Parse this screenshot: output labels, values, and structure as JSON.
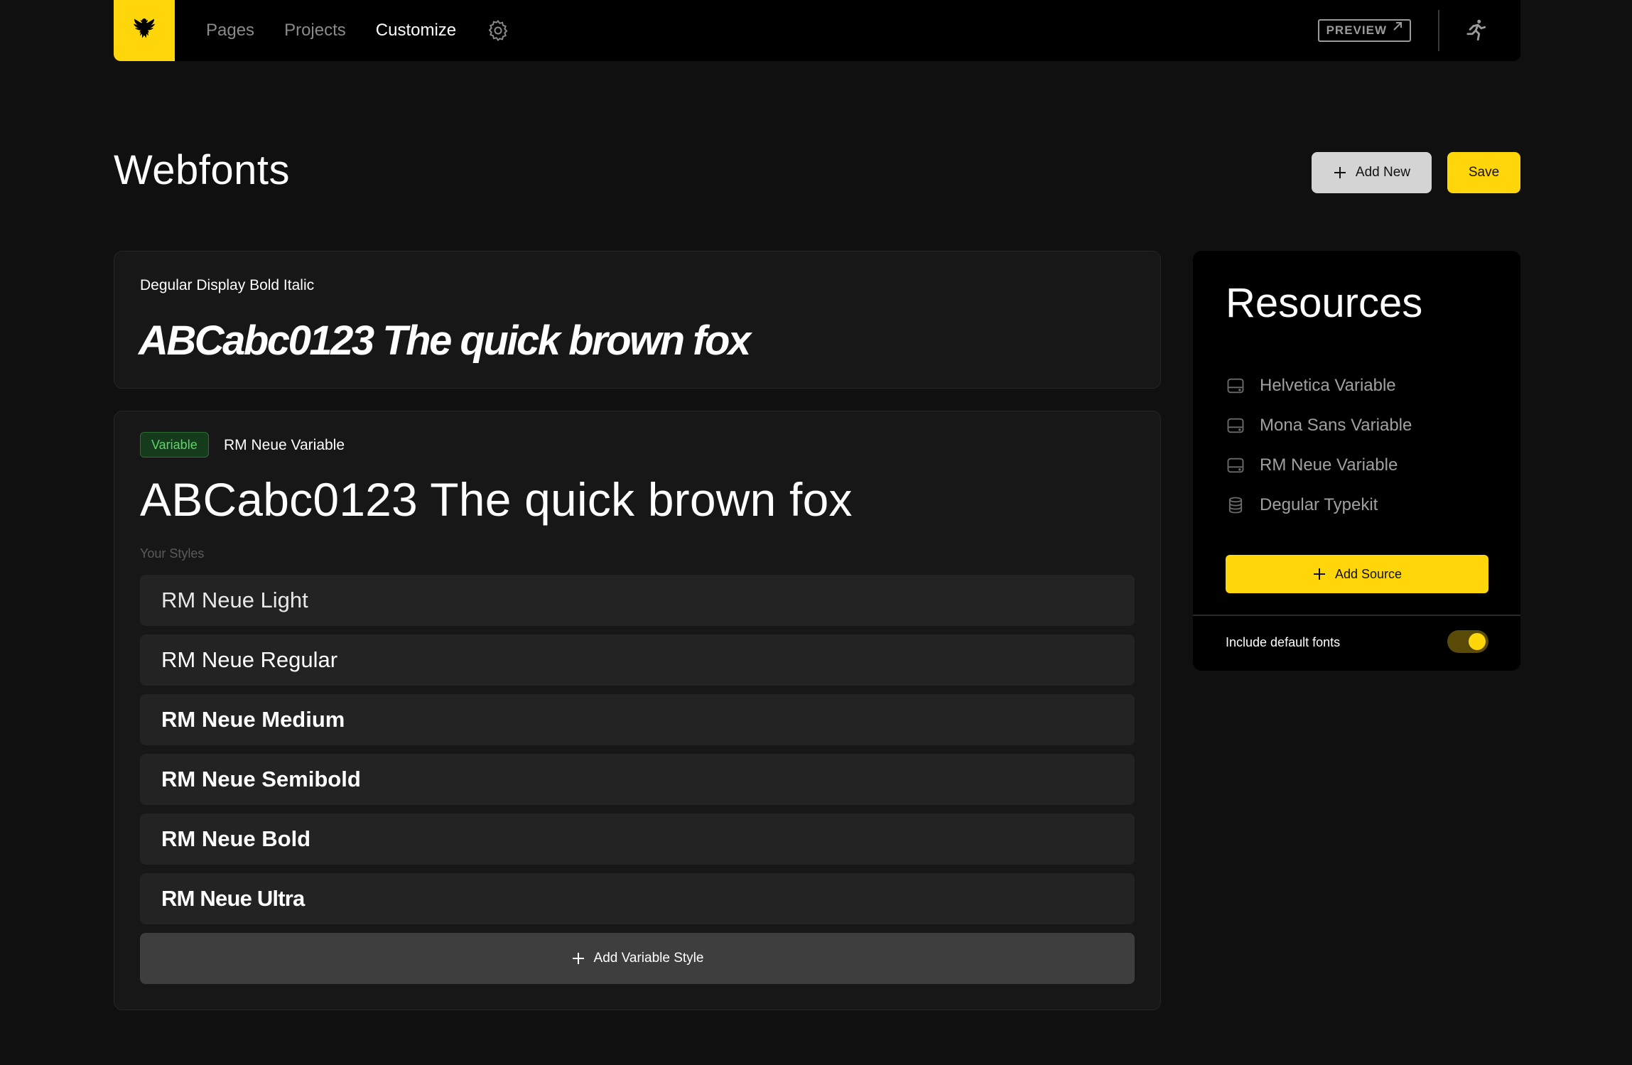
{
  "nav": {
    "logo_icon": "eagle-crest-icon",
    "links": [
      {
        "label": "Pages",
        "active": false
      },
      {
        "label": "Projects",
        "active": false
      },
      {
        "label": "Customize",
        "active": true
      }
    ],
    "settings_icon": "gear-icon",
    "preview_label": "PREVIEW",
    "run_icon": "running-person-icon"
  },
  "header": {
    "title": "Webfonts",
    "add_new_label": "Add New",
    "save_label": "Save"
  },
  "fonts": [
    {
      "name": "Degular Display Bold Italic",
      "sample": "ABCabc0123 The quick brown fox"
    },
    {
      "badge": "Variable",
      "name": "RM Neue Variable",
      "sample": "ABCabc0123 The quick brown fox",
      "styles_label": "Your Styles",
      "styles": [
        "RM Neue Light",
        "RM Neue Regular",
        "RM Neue Medium",
        "RM Neue Semibold",
        "RM Neue Bold",
        "RM Neue Ultra"
      ],
      "add_style_label": "Add Variable Style"
    }
  ],
  "resources": {
    "title": "Resources",
    "items": [
      {
        "label": "Helvetica Variable",
        "icon": "drive-icon"
      },
      {
        "label": "Mona Sans Variable",
        "icon": "drive-icon"
      },
      {
        "label": "RM Neue Variable",
        "icon": "drive-icon"
      },
      {
        "label": "Degular Typekit",
        "icon": "database-icon"
      }
    ],
    "add_source_label": "Add Source",
    "include_default_label": "Include default fonts",
    "include_default_on": true
  },
  "colors": {
    "accent": "#ffd60a",
    "background": "#101010",
    "card": "#171717",
    "badge_green": "#5fd36a"
  }
}
